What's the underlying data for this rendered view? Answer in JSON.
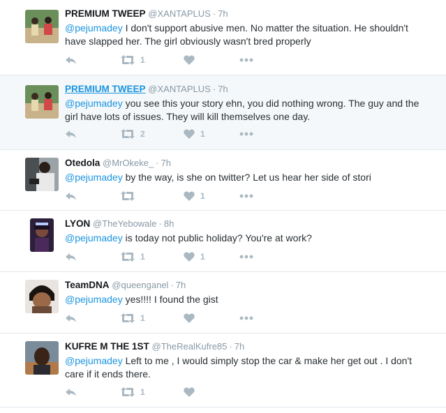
{
  "tweets": [
    {
      "name": "PREMIUM TWEEP",
      "handle": "@XANTAPLUS",
      "time": "7h",
      "mention": "@pejumadey",
      "text": "I don't support abusive men. No matter the situation. He shouldn't have slapped her. The girl obviously wasn't bred properly",
      "retweets": "1",
      "likes": "",
      "hover": false,
      "name_underline": false
    },
    {
      "name": "PREMIUM TWEEP",
      "handle": "@XANTAPLUS",
      "time": "7h",
      "mention": "@pejumadey",
      "text": "you see this your story ehn,  you did nothing wrong. The guy and the girl have lots of issues. They will kill themselves one day.",
      "retweets": "2",
      "likes": "1",
      "hover": true,
      "name_underline": true
    },
    {
      "name": "Otedola",
      "handle": "@MrOkeke_",
      "time": "7h",
      "mention": "@pejumadey",
      "text": "by the way, is she on twitter? Let us hear her side of stori",
      "retweets": "",
      "likes": "1",
      "hover": false,
      "name_underline": false
    },
    {
      "name": "LYON",
      "handle": "@TheYebowale",
      "time": "8h",
      "mention": "@pejumadey",
      "text": "is today not public holiday? You're at work?",
      "retweets": "1",
      "likes": "1",
      "hover": false,
      "name_underline": false
    },
    {
      "name": "TeamDNA",
      "handle": "@queenganel",
      "time": "7h",
      "mention": "@pejumadey",
      "text": "yes!!!! I found the gist",
      "retweets": "1",
      "likes": "",
      "hover": false,
      "name_underline": false
    },
    {
      "name": "KUFRE M THE 1ST",
      "handle": "@TheRealKufre85",
      "time": "7h",
      "mention": "@pejumadey",
      "text": "Left to me , I would simply stop the car & make her get out . I don't care if it ends there.",
      "retweets": "1",
      "likes": "",
      "hover": false,
      "name_underline": false
    }
  ],
  "icons": {
    "reply": "reply-icon",
    "retweet": "retweet-icon",
    "like": "heart-icon",
    "more": "more-icon"
  },
  "colors": {
    "mention": "#1b95e0",
    "meta": "#8899a6",
    "icon": "#aab8c2",
    "hover_bg": "#f5f8fa",
    "border": "#e1e8ed"
  }
}
